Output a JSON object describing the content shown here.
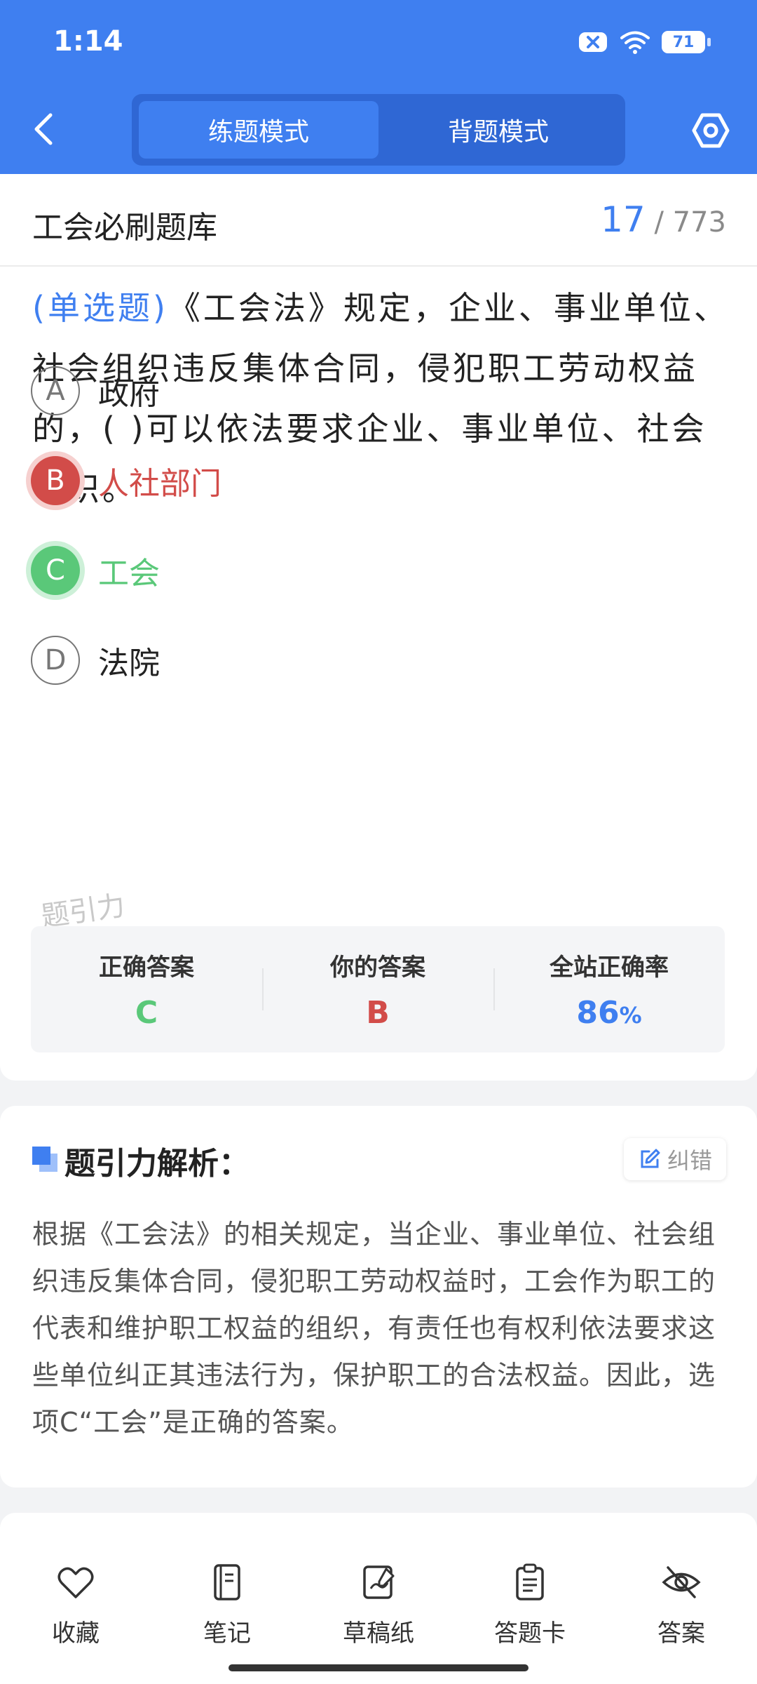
{
  "status": {
    "time": "1:14",
    "battery": "71"
  },
  "header": {
    "tabs": [
      "练题模式",
      "背题模式"
    ],
    "active_tab": 0
  },
  "title_bar": {
    "title": "工会必刷题库",
    "current": "17",
    "total": "/ 773"
  },
  "question": {
    "type": "(单选题)",
    "text": "《工会法》规定，企业、事业单位、社会组织违反集体合同，侵犯职工劳动权益的，( )可以依法要求企业、事业单位、社会组织。",
    "options": [
      {
        "letter": "A",
        "label": "政府",
        "state": "normal"
      },
      {
        "letter": "B",
        "label": "人社部门",
        "state": "wrong"
      },
      {
        "letter": "C",
        "label": "工会",
        "state": "correct"
      },
      {
        "letter": "D",
        "label": "法院",
        "state": "normal"
      }
    ],
    "watermark": "题引力"
  },
  "answer_panel": {
    "correct_label": "正确答案",
    "correct_value": "C",
    "your_label": "你的答案",
    "your_value": "B",
    "rate_label": "全站正确率",
    "rate_value": "86",
    "rate_unit": "%"
  },
  "analysis": {
    "title": "题引力解析：",
    "report_label": "纠错",
    "text": "根据《工会法》的相关规定，当企业、事业单位、社会组织违反集体合同，侵犯职工劳动权益时，工会作为职工的代表和维护职工权益的组织，有责任也有权利依法要求这些单位纠正其违法行为，保护职工的合法权益。因此，选项C“工会”是正确的答案。"
  },
  "bottom_nav": {
    "items": [
      {
        "label": "收藏",
        "icon": "heart-icon"
      },
      {
        "label": "笔记",
        "icon": "notebook-icon"
      },
      {
        "label": "草稿纸",
        "icon": "draft-icon"
      },
      {
        "label": "答题卡",
        "icon": "clipboard-icon"
      },
      {
        "label": "答案",
        "icon": "eye-off-icon"
      }
    ]
  },
  "colors": {
    "primary": "#3f7ff0",
    "correct": "#5ac879",
    "wrong": "#d24c49"
  }
}
